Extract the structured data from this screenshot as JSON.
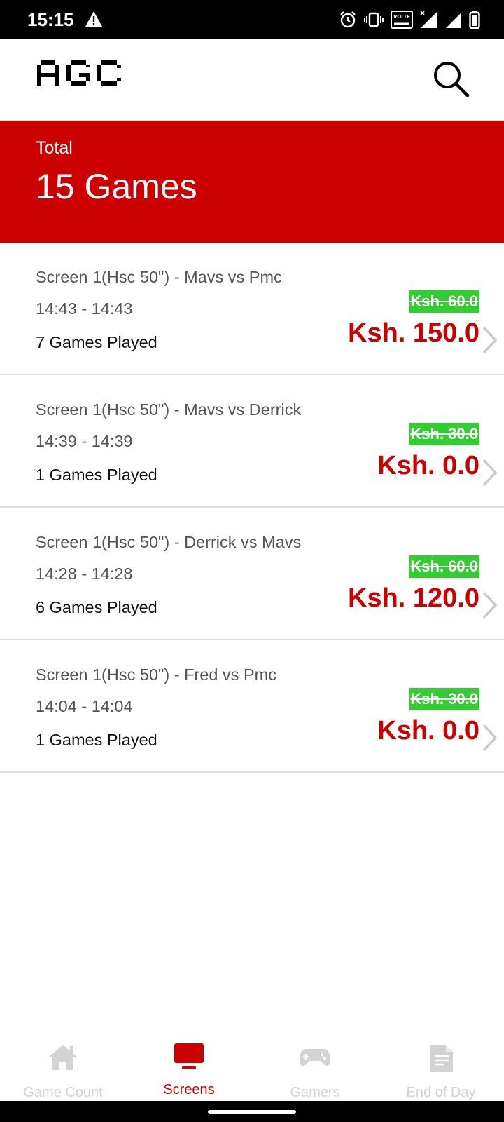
{
  "status_bar": {
    "time": "15:15",
    "icons": [
      "warning-icon",
      "alarm-icon",
      "vibrate-icon",
      "volte-icon",
      "signal-icon",
      "signal-icon",
      "battery-icon"
    ],
    "volte_label": "VOLTE"
  },
  "app_bar": {
    "logo_text": "AGC",
    "search_icon": "search-icon"
  },
  "summary": {
    "label": "Total",
    "value": "15 Games"
  },
  "sessions": [
    {
      "title": "Screen 1(Hsc 50\") - Mavs vs Pmc",
      "time": "14:43 - 14:43",
      "played": "7 Games Played",
      "old_price": "Ksh. 60.0",
      "price": "Ksh. 150.0"
    },
    {
      "title": "Screen 1(Hsc 50\") - Mavs vs Derrick",
      "time": "14:39 - 14:39",
      "played": "1 Games Played",
      "old_price": "Ksh. 30.0",
      "price": "Ksh. 0.0"
    },
    {
      "title": "Screen 1(Hsc 50\") - Derrick vs Mavs",
      "time": "14:28 - 14:28",
      "played": "6 Games Played",
      "old_price": "Ksh. 60.0",
      "price": "Ksh. 120.0"
    },
    {
      "title": "Screen 1(Hsc 50\") - Fred vs Pmc",
      "time": "14:04 - 14:04",
      "played": "1 Games Played",
      "old_price": "Ksh. 30.0",
      "price": "Ksh. 0.0"
    }
  ],
  "bottom_nav": {
    "items": [
      {
        "label": "Game Count",
        "icon": "home-icon",
        "active": false
      },
      {
        "label": "Screens",
        "icon": "monitor-icon",
        "active": true
      },
      {
        "label": "Gamers",
        "icon": "gamepad-icon",
        "active": false
      },
      {
        "label": "End of Day",
        "icon": "document-icon",
        "active": false
      }
    ]
  },
  "colors": {
    "brand_red": "#cc0000",
    "discount_green": "#33cc33",
    "inactive_nav": "#d3d3d3"
  }
}
